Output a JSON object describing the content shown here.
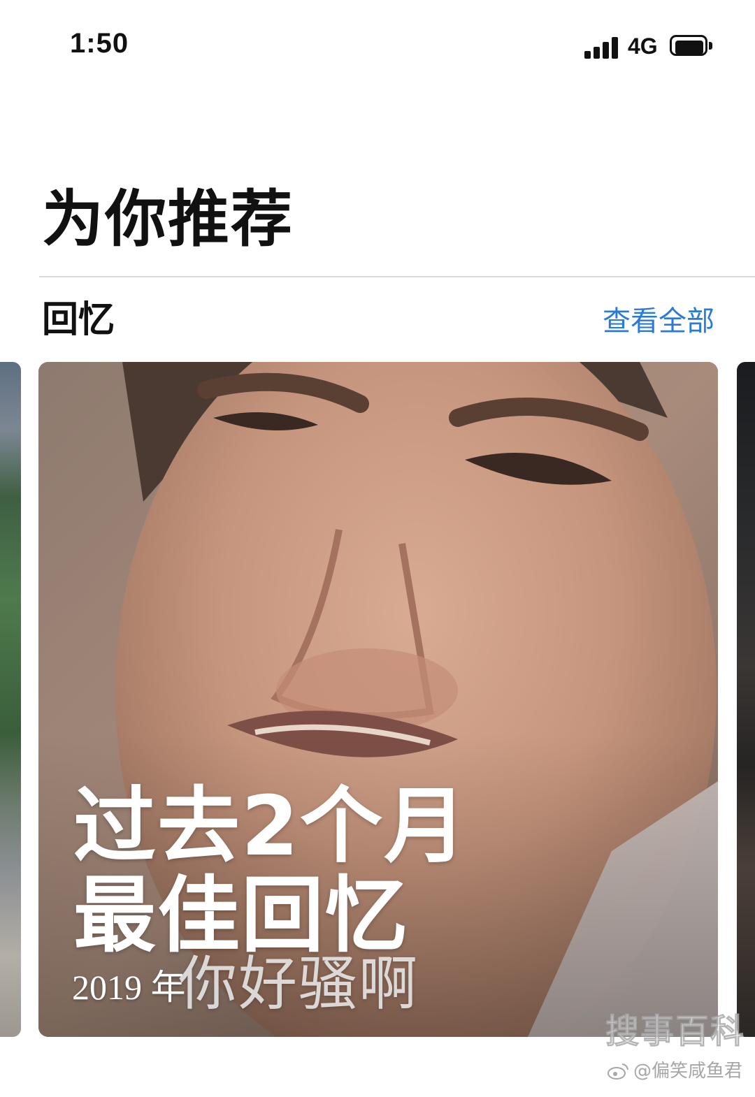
{
  "status_bar": {
    "time": "1:50",
    "network": "4G",
    "signal_icon": "signal-bars-icon",
    "battery_icon": "battery-icon"
  },
  "header": {
    "title": "为你推荐"
  },
  "section": {
    "title": "回忆",
    "see_all_label": "查看全部",
    "see_all_color": "#2a7bd8"
  },
  "memory_card": {
    "title_line1": "过去2个月",
    "title_line2": "最佳回忆",
    "year": "2019 年",
    "caption": "你好骚啊"
  },
  "watermark": {
    "logo_text": "搜事百科",
    "handle": "@偏笑咸鱼君",
    "icon": "weibo-icon"
  }
}
